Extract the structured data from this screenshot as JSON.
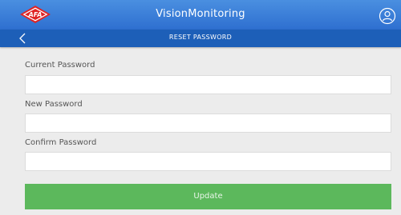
{
  "header": {
    "app_title": "VisionMonitoring",
    "logo_text": "AFA",
    "brand_color": "#2e6fd0",
    "logo_color": "#e02424"
  },
  "subheader": {
    "title": "RESET PASSWORD",
    "back_icon": "chevron-left-icon",
    "color": "#1d5fb8"
  },
  "form": {
    "current_password_label": "Current Password",
    "current_password_value": "",
    "new_password_label": "New Password",
    "new_password_value": "",
    "confirm_password_label": "Confirm Password",
    "confirm_password_value": "",
    "update_label": "Update",
    "update_color": "#5cb85c"
  },
  "icons": {
    "user": "user-circle-icon"
  }
}
